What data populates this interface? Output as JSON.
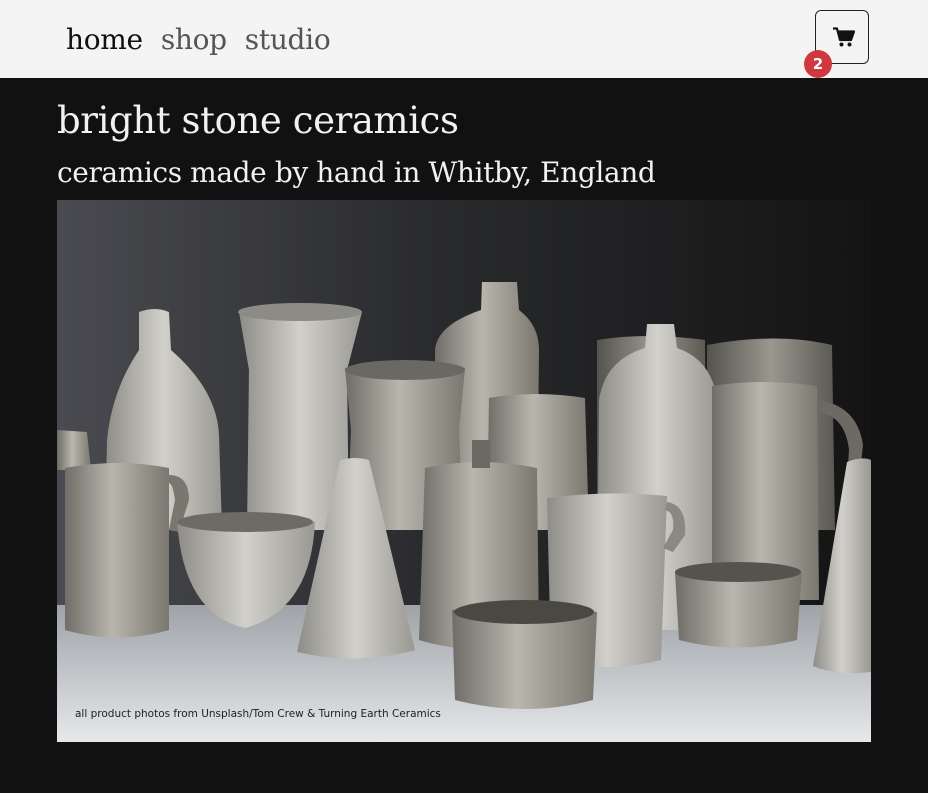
{
  "nav": {
    "links": [
      {
        "label": "home",
        "active": true
      },
      {
        "label": "shop",
        "active": false
      },
      {
        "label": "studio",
        "active": false
      }
    ],
    "cart": {
      "icon": "cart-icon",
      "count": "2",
      "badge_color": "#d0373f"
    }
  },
  "header": {
    "title": "bright stone ceramics",
    "tagline": "ceramics made by hand in Whitby, England"
  },
  "hero": {
    "image_subject": "still life of stoneware pottery",
    "caption": "all product photos from Unsplash/Tom Crew & Turning Earth Ceramics"
  },
  "colors": {
    "page_background": "#111111",
    "navbar_background": "#f4f4f4",
    "text_light": "#f1f1f1",
    "badge": "#d0373f"
  }
}
